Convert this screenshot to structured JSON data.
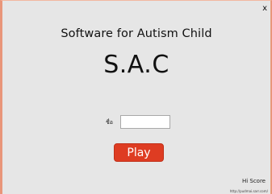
{
  "window": {
    "close_glyph": "x",
    "border_color": "#e9967a",
    "background_color": "#e6e6e6"
  },
  "title": "Software for Autism Child",
  "logo": "S.A.C",
  "name_field": {
    "label": "ชื่อ",
    "value": "",
    "placeholder": ""
  },
  "play_button": {
    "label": "Play",
    "color": "#de3c22"
  },
  "hi_score_link": "Hi Score",
  "footer_url": "http://pudmai.sarr.com/"
}
